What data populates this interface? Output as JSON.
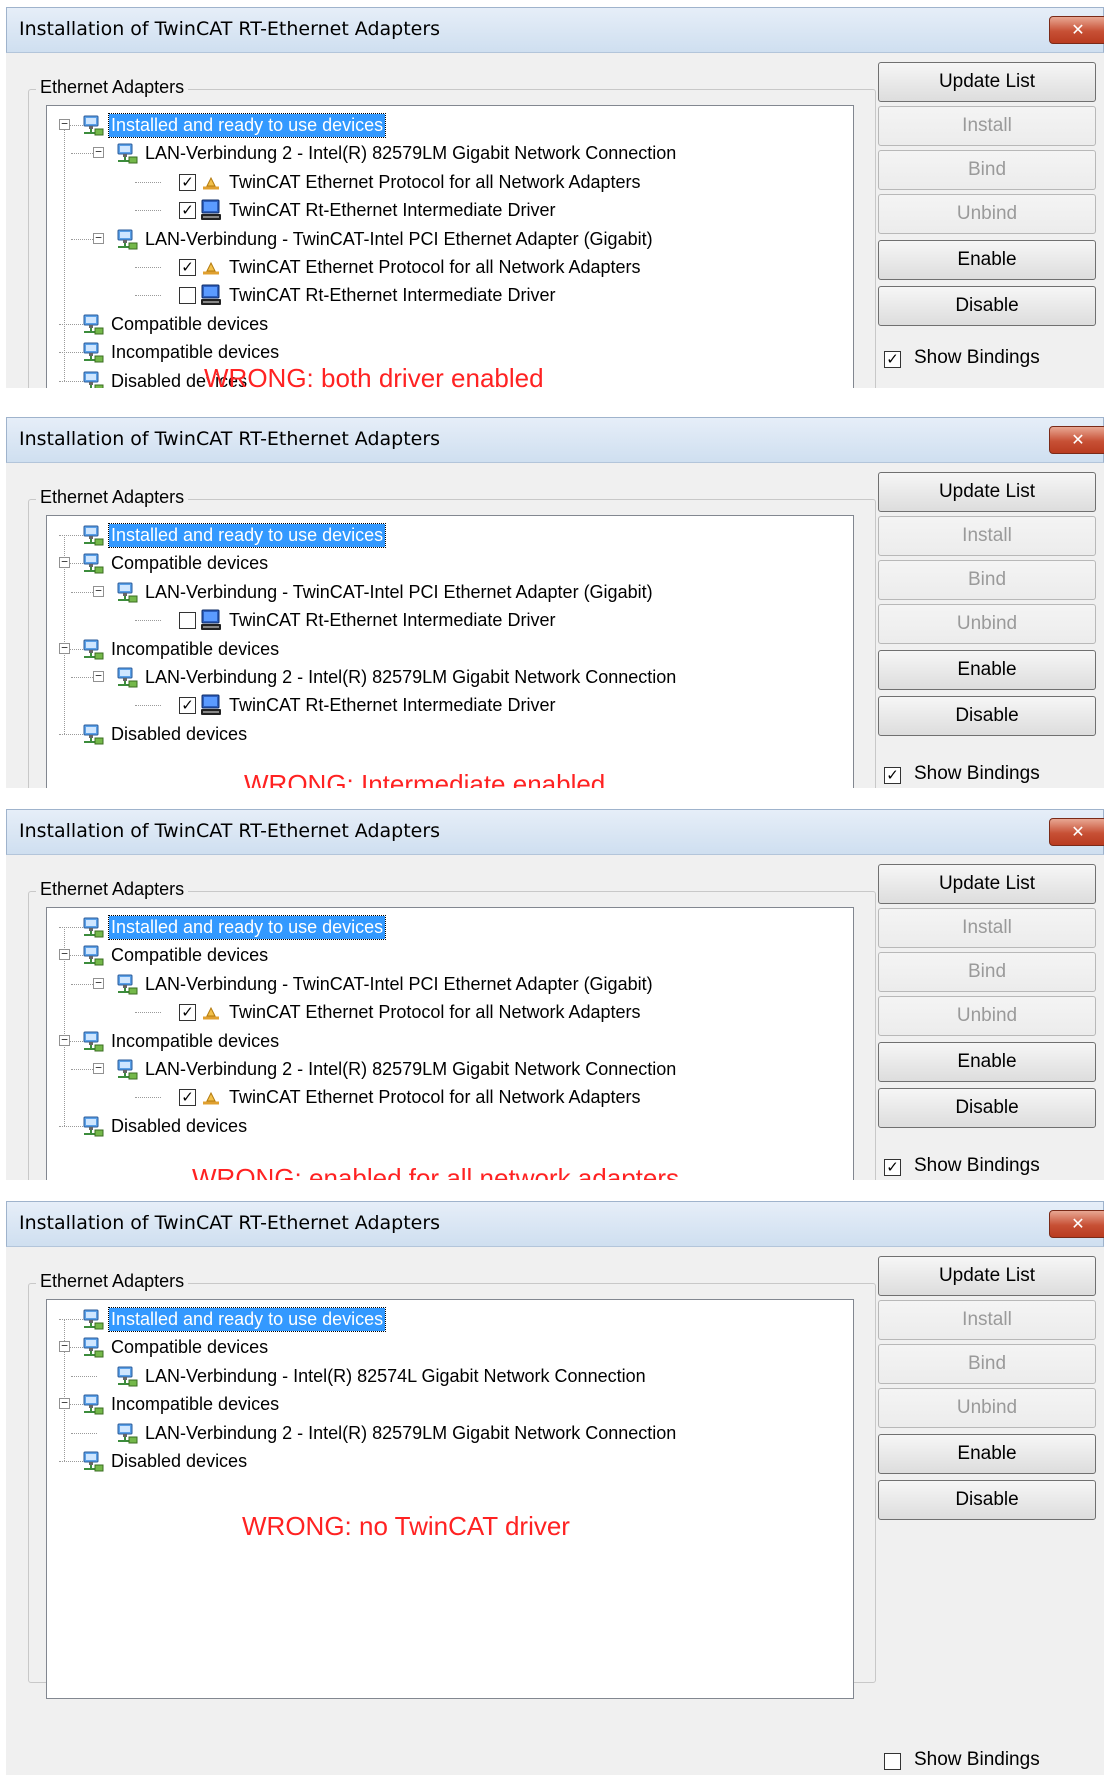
{
  "panels": [
    {
      "title": "Installation of TwinCAT RT-Ethernet Adapters",
      "close_glyph": "✕",
      "group_label": "Ethernet Adapters",
      "warning": "WRONG: both driver enabled",
      "show_bindings": {
        "label": "Show Bindings",
        "checked": true
      },
      "buttons": [
        {
          "label": "Update List",
          "enabled": true
        },
        {
          "label": "Install",
          "enabled": false
        },
        {
          "label": "Bind",
          "enabled": false
        },
        {
          "label": "Unbind",
          "enabled": false
        },
        {
          "label": "Enable",
          "enabled": true
        },
        {
          "label": "Disable",
          "enabled": true
        }
      ],
      "tree": [
        {
          "level": 0,
          "icon": "network-adapter-icon",
          "label": "Installed and ready to use devices",
          "expanded": true,
          "selected": true
        },
        {
          "level": 1,
          "icon": "network-adapter-icon",
          "label": "LAN-Verbindung 2 - Intel(R) 82579LM Gigabit Network Connection",
          "expanded": true
        },
        {
          "level": 2,
          "icon": "protocol-icon",
          "checkbox": true,
          "checked": true,
          "label": "TwinCAT Ethernet Protocol for all Network Adapters"
        },
        {
          "level": 2,
          "icon": "driver-icon",
          "checkbox": true,
          "checked": true,
          "label": "TwinCAT Rt-Ethernet Intermediate Driver"
        },
        {
          "level": 1,
          "icon": "network-adapter-icon",
          "label": "LAN-Verbindung - TwinCAT-Intel PCI Ethernet Adapter (Gigabit)",
          "expanded": true
        },
        {
          "level": 2,
          "icon": "protocol-icon",
          "checkbox": true,
          "checked": true,
          "label": "TwinCAT Ethernet Protocol for all Network Adapters"
        },
        {
          "level": 2,
          "icon": "driver-icon",
          "checkbox": true,
          "checked": false,
          "label": "TwinCAT Rt-Ethernet Intermediate Driver"
        },
        {
          "level": 0,
          "icon": "network-adapter-icon",
          "label": "Compatible devices"
        },
        {
          "level": 0,
          "icon": "network-adapter-icon",
          "label": "Incompatible devices"
        },
        {
          "level": 0,
          "icon": "network-adapter-icon",
          "label": "Disabled devices"
        }
      ]
    },
    {
      "title": "Installation of TwinCAT RT-Ethernet Adapters",
      "close_glyph": "✕",
      "group_label": "Ethernet Adapters",
      "warning": "WRONG: Intermediate enabled",
      "show_bindings": {
        "label": "Show Bindings",
        "checked": true
      },
      "buttons": [
        {
          "label": "Update List",
          "enabled": true
        },
        {
          "label": "Install",
          "enabled": false
        },
        {
          "label": "Bind",
          "enabled": false
        },
        {
          "label": "Unbind",
          "enabled": false
        },
        {
          "label": "Enable",
          "enabled": true
        },
        {
          "label": "Disable",
          "enabled": true
        }
      ],
      "tree": [
        {
          "level": 0,
          "icon": "network-adapter-icon",
          "label": "Installed and ready to use devices",
          "selected": true
        },
        {
          "level": 0,
          "icon": "network-adapter-icon",
          "label": "Compatible devices",
          "expanded": true
        },
        {
          "level": 1,
          "icon": "network-adapter-icon",
          "label": "LAN-Verbindung - TwinCAT-Intel PCI Ethernet Adapter (Gigabit)",
          "expanded": true
        },
        {
          "level": 2,
          "icon": "driver-icon",
          "checkbox": true,
          "checked": false,
          "label": "TwinCAT Rt-Ethernet Intermediate Driver"
        },
        {
          "level": 0,
          "icon": "network-adapter-icon",
          "label": "Incompatible devices",
          "expanded": true
        },
        {
          "level": 1,
          "icon": "network-adapter-icon",
          "label": "LAN-Verbindung 2 - Intel(R) 82579LM Gigabit Network Connection",
          "expanded": true
        },
        {
          "level": 2,
          "icon": "driver-icon",
          "checkbox": true,
          "checked": true,
          "label": "TwinCAT Rt-Ethernet Intermediate Driver"
        },
        {
          "level": 0,
          "icon": "network-adapter-icon",
          "label": "Disabled devices"
        }
      ]
    },
    {
      "title": "Installation of TwinCAT RT-Ethernet Adapters",
      "close_glyph": "✕",
      "group_label": "Ethernet Adapters",
      "warning": "WRONG: enabled for all network adapters",
      "show_bindings": {
        "label": "Show Bindings",
        "checked": true
      },
      "buttons": [
        {
          "label": "Update List",
          "enabled": true
        },
        {
          "label": "Install",
          "enabled": false
        },
        {
          "label": "Bind",
          "enabled": false
        },
        {
          "label": "Unbind",
          "enabled": false
        },
        {
          "label": "Enable",
          "enabled": true
        },
        {
          "label": "Disable",
          "enabled": true
        }
      ],
      "tree": [
        {
          "level": 0,
          "icon": "network-adapter-icon",
          "label": "Installed and ready to use devices",
          "selected": true
        },
        {
          "level": 0,
          "icon": "network-adapter-icon",
          "label": "Compatible devices",
          "expanded": true
        },
        {
          "level": 1,
          "icon": "network-adapter-icon",
          "label": "LAN-Verbindung - TwinCAT-Intel PCI Ethernet Adapter (Gigabit)",
          "expanded": true
        },
        {
          "level": 2,
          "icon": "protocol-icon",
          "checkbox": true,
          "checked": true,
          "label": "TwinCAT Ethernet Protocol for all Network Adapters"
        },
        {
          "level": 0,
          "icon": "network-adapter-icon",
          "label": "Incompatible devices",
          "expanded": true
        },
        {
          "level": 1,
          "icon": "network-adapter-icon",
          "label": "LAN-Verbindung 2 - Intel(R) 82579LM Gigabit Network Connection",
          "expanded": true
        },
        {
          "level": 2,
          "icon": "protocol-icon",
          "checkbox": true,
          "checked": true,
          "label": "TwinCAT Ethernet Protocol for all Network Adapters"
        },
        {
          "level": 0,
          "icon": "network-adapter-icon",
          "label": "Disabled devices"
        }
      ]
    },
    {
      "title": "Installation of TwinCAT RT-Ethernet Adapters",
      "close_glyph": "✕",
      "group_label": "Ethernet Adapters",
      "warning": "WRONG: no TwinCAT driver",
      "show_bindings": {
        "label": "Show Bindings",
        "checked": false
      },
      "buttons": [
        {
          "label": "Update List",
          "enabled": true
        },
        {
          "label": "Install",
          "enabled": false
        },
        {
          "label": "Bind",
          "enabled": false
        },
        {
          "label": "Unbind",
          "enabled": false
        },
        {
          "label": "Enable",
          "enabled": true
        },
        {
          "label": "Disable",
          "enabled": true
        }
      ],
      "tree": [
        {
          "level": 0,
          "icon": "network-adapter-icon",
          "label": "Installed and ready to use devices",
          "selected": true
        },
        {
          "level": 0,
          "icon": "network-adapter-icon",
          "label": "Compatible devices",
          "expanded": true
        },
        {
          "level": 1,
          "icon": "network-adapter-icon",
          "label": "LAN-Verbindung - Intel(R) 82574L Gigabit Network Connection"
        },
        {
          "level": 0,
          "icon": "network-adapter-icon",
          "label": "Incompatible devices",
          "expanded": true
        },
        {
          "level": 1,
          "icon": "network-adapter-icon",
          "label": "LAN-Verbindung 2 - Intel(R) 82579LM Gigabit Network Connection"
        },
        {
          "level": 0,
          "icon": "network-adapter-icon",
          "label": "Disabled devices"
        }
      ]
    }
  ]
}
